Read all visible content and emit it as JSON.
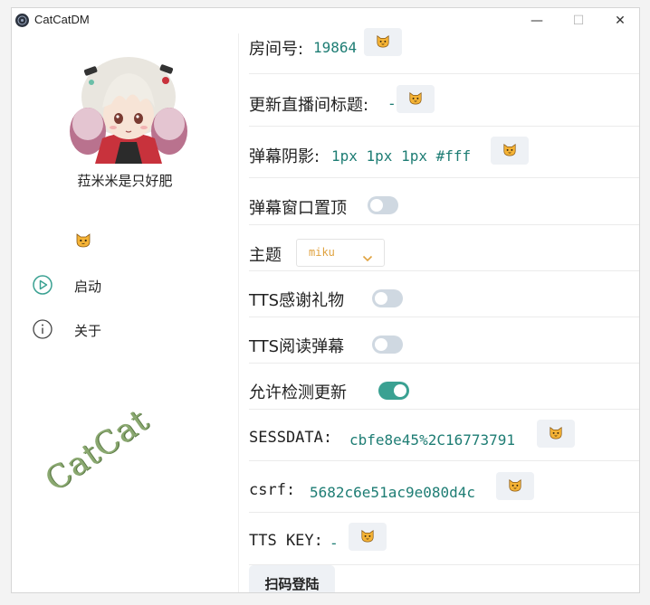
{
  "window": {
    "title": "CatCatDM",
    "minimize_glyph": "—",
    "maximize_glyph": "☐",
    "close_glyph": "✕"
  },
  "sidebar": {
    "username": "菈米米是只好肥",
    "cat_icon": "cat-face-icon",
    "nav": [
      {
        "label": "启动",
        "icon": "play-circle-icon"
      },
      {
        "label": "关于",
        "icon": "info-circle-icon"
      }
    ],
    "watermark": "CatCat"
  },
  "settings": {
    "room_id": {
      "label": "房间号:",
      "value": "19864"
    },
    "update_title": {
      "label": "更新直播间标题:",
      "value": "-"
    },
    "danmaku_shadow": {
      "label": "弹幕阴影:",
      "value": "1px 1px 1px #fff"
    },
    "danmaku_topmost": {
      "label": "弹幕窗口置顶",
      "enabled": false
    },
    "theme": {
      "label": "主题",
      "selected": "miku"
    },
    "tts_gift": {
      "label": "TTS感谢礼物",
      "enabled": false
    },
    "tts_read": {
      "label": "TTS阅读弹幕",
      "enabled": false
    },
    "allow_update_check": {
      "label": "允许检测更新",
      "enabled": true
    },
    "sessdata": {
      "label": "SESSDATA:",
      "value": "cbfe8e45%2C16773791"
    },
    "csrf": {
      "label": "csrf:",
      "value": "5682c6e51ac9e080d4c"
    },
    "tts_key": {
      "label": "TTS KEY:",
      "value": "-"
    },
    "login_button": "扫码登陆"
  },
  "colors": {
    "accent": "#1e7d74",
    "toggle_on": "#3aa192",
    "toggle_off": "#cfd8e1",
    "select_text": "#e0a341",
    "nav_play_icon": "#3aa192"
  }
}
